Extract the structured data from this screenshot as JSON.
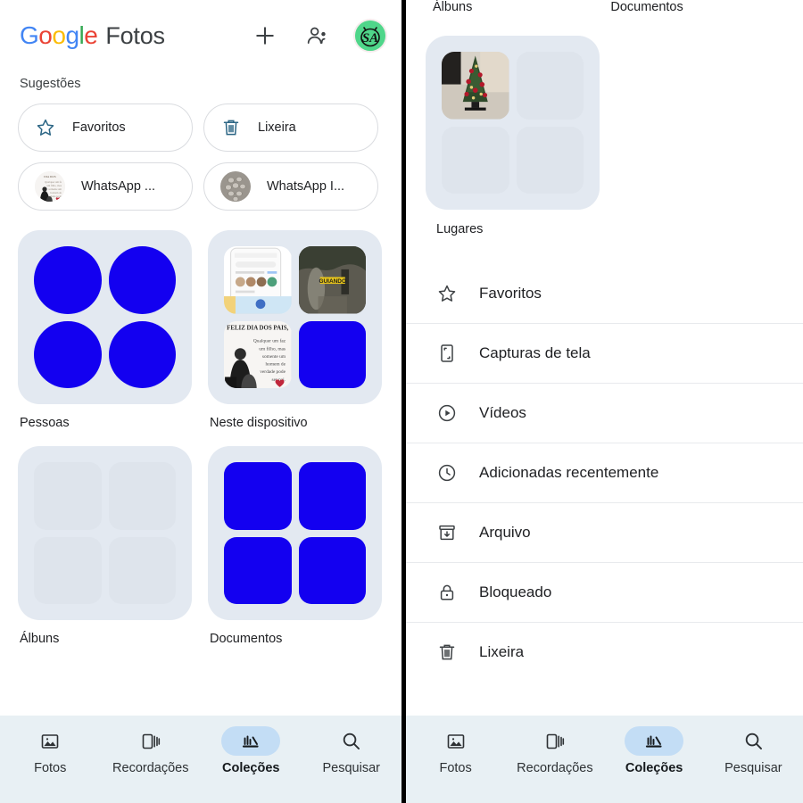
{
  "colors": {
    "accent_blue": "#1300f0",
    "card_bg": "#e3e9f1",
    "tile_bg": "#dee4ec",
    "nav_bg": "#e8f0f4",
    "nav_active_pill": "#c3ddf5",
    "divider": "#000000",
    "text": "#202124"
  },
  "header": {
    "logo_letters": [
      "G",
      "o",
      "o",
      "g",
      "l",
      "e"
    ],
    "brand_word": "Fotos",
    "add_label": "+",
    "add_icon": "plus-icon",
    "partner_icon": "people-icon",
    "avatar_icon": "avatar-android-sa",
    "avatar_text": "SA"
  },
  "suggestions": {
    "section_label": "Sugestões",
    "chips": [
      {
        "label": "Favoritos",
        "icon": "star-icon",
        "thumb": false
      },
      {
        "label": "Lixeira",
        "icon": "trash-icon",
        "thumb": false
      },
      {
        "label": "WhatsApp ...",
        "icon": "photo-thumb-dia-dos-pais",
        "thumb": true
      },
      {
        "label": "WhatsApp I...",
        "icon": "photo-thumb-pills",
        "thumb": true
      }
    ]
  },
  "collections": {
    "cards": [
      {
        "label": "Pessoas",
        "shape": "circle",
        "tiles": [
          "blue",
          "blue",
          "blue",
          "blue"
        ]
      },
      {
        "label": "Neste dispositivo",
        "shape": "rounded",
        "tiles": [
          "photo-app-screenshot",
          "photo-guiando",
          "photo-feliz-dia-dos-pais",
          "blue"
        ]
      },
      {
        "label": "Álbuns",
        "shape": "rounded",
        "tiles": [
          "empty",
          "empty",
          "empty",
          "empty"
        ]
      },
      {
        "label": "Documentos",
        "shape": "rounded",
        "tiles": [
          "blue",
          "blue",
          "blue",
          "blue"
        ]
      }
    ]
  },
  "right_panel": {
    "top_labels": [
      "Álbuns",
      "Documentos"
    ],
    "card": {
      "label": "Lugares",
      "shape": "rounded",
      "tiles": [
        "photo-christmas-tree",
        "empty",
        "empty",
        "empty"
      ]
    },
    "list": [
      {
        "label": "Favoritos",
        "icon": "star-icon"
      },
      {
        "label": "Capturas de tela",
        "icon": "screenshot-icon"
      },
      {
        "label": "Vídeos",
        "icon": "play-circle-icon"
      },
      {
        "label": "Adicionadas recentemente",
        "icon": "clock-icon"
      },
      {
        "label": "Arquivo",
        "icon": "archive-icon"
      },
      {
        "label": "Bloqueado",
        "icon": "lock-icon"
      },
      {
        "label": "Lixeira",
        "icon": "trash-icon"
      }
    ]
  },
  "bottom_nav": {
    "items": [
      {
        "label": "Fotos",
        "icon": "photo-icon",
        "active": false
      },
      {
        "label": "Recordações",
        "icon": "memories-icon",
        "active": false
      },
      {
        "label": "Coleções",
        "icon": "collections-icon",
        "active": true
      },
      {
        "label": "Pesquisar",
        "icon": "search-icon",
        "active": false
      }
    ]
  }
}
